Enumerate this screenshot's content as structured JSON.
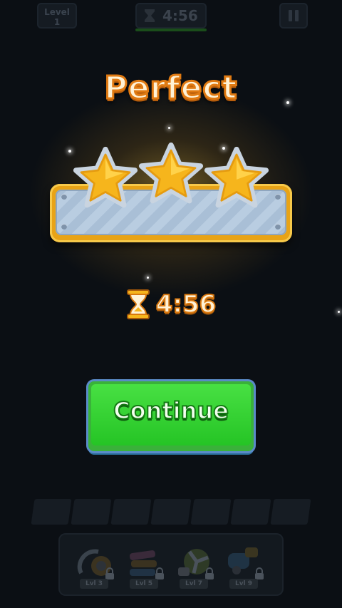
{
  "hud": {
    "level_label": "Level",
    "level_number": "1",
    "timer": "4:56",
    "pause_icon": "pause-icon"
  },
  "result": {
    "title": "Perfect",
    "stars_earned": 3,
    "stars_total": 3,
    "time": "4:56"
  },
  "continue_label": "Continue",
  "tools": [
    {
      "name": "vacuum",
      "level": "Lvl 3"
    },
    {
      "name": "magnet",
      "level": "Lvl 5"
    },
    {
      "name": "fan",
      "level": "Lvl 7"
    },
    {
      "name": "freeze",
      "level": "Lvl 9"
    }
  ],
  "colors": {
    "background": "#0b0f14",
    "title_orange": "#e07a12",
    "star_gold": "#f6b51c",
    "continue_green": "#2fd12f"
  }
}
